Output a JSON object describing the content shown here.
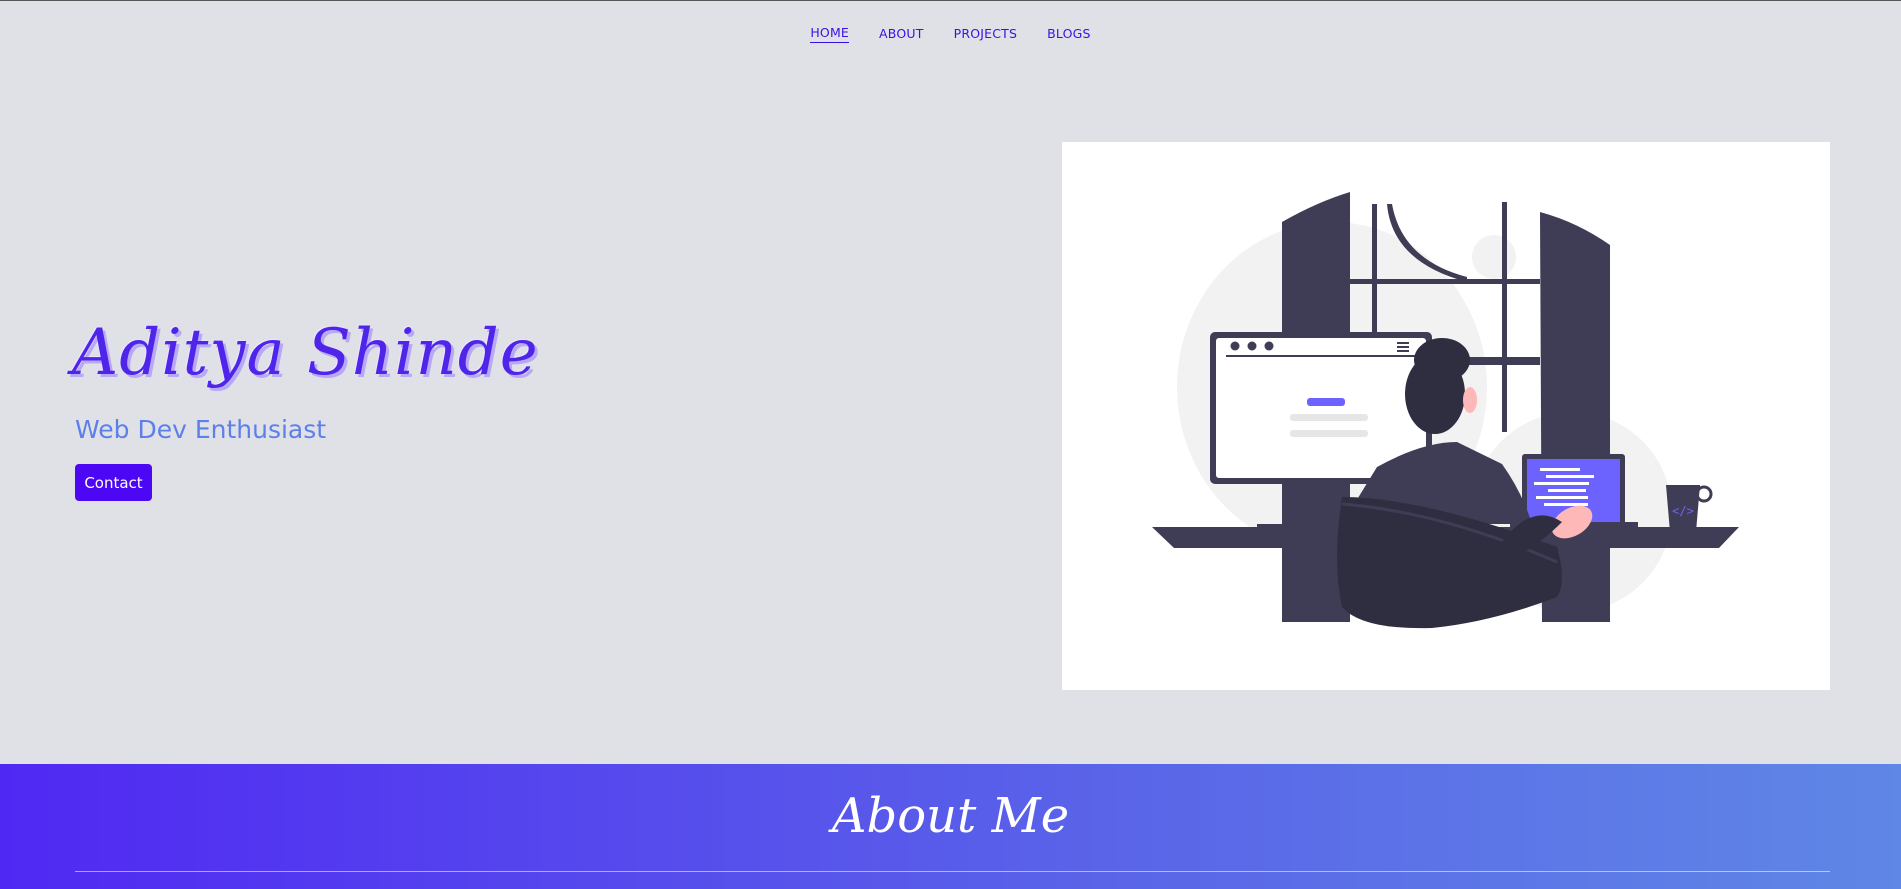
{
  "nav": {
    "items": [
      {
        "label": "HOME",
        "active": true
      },
      {
        "label": "ABOUT",
        "active": false
      },
      {
        "label": "PROJECTS",
        "active": false
      },
      {
        "label": "BLOGS",
        "active": false
      }
    ]
  },
  "hero": {
    "name": "Aditya Shinde",
    "subtitle": "Web Dev Enthusiast",
    "contact_label": "Contact",
    "illustration_icon": "developer-at-desk-illustration"
  },
  "about": {
    "title": "About Me"
  },
  "colors": {
    "accent": "#4c07f5",
    "nav_link": "#3a10e5",
    "subtitle": "#5d7fea",
    "page_bg": "#e0e1e6",
    "illustration_purple": "#6c63ff",
    "illustration_dark": "#3f3d56"
  }
}
